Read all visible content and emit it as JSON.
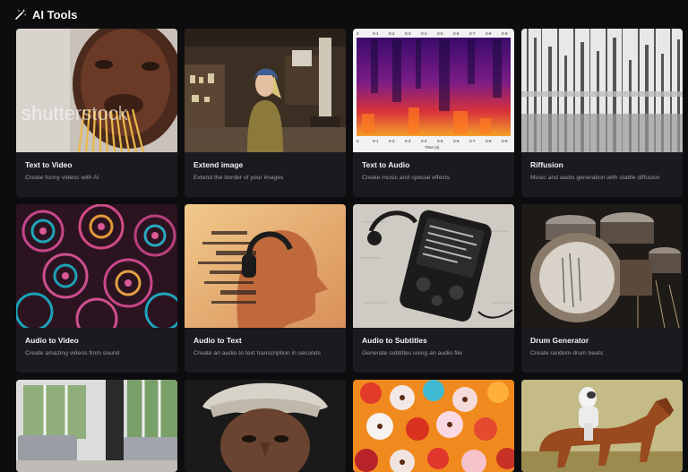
{
  "header": {
    "icon": "magic-wand-icon",
    "title": "AI Tools"
  },
  "cards": [
    {
      "title": "Text to Video",
      "description": "Create funny videos with AI"
    },
    {
      "title": "Extend image",
      "description": "Extend the border of your images"
    },
    {
      "title": "Text to Audio",
      "description": "Create music and special effects"
    },
    {
      "title": "Riffusion",
      "description": "Music and audio generation with stable diffusion"
    },
    {
      "title": "Audio to Video",
      "description": "Create amazing videos from sound"
    },
    {
      "title": "Audio to Text",
      "description": "Create an audio to text transcription in seconds"
    },
    {
      "title": "Audio to Subtitles",
      "description": "Generate subtitles using an audio file"
    },
    {
      "title": "Drum Generator",
      "description": "Create random drum beats"
    }
  ],
  "thumb_text": {
    "watermark": "shutterstock",
    "spectrogram_axis": "Time (s)",
    "spectrogram_ticks": [
      "0",
      "0-1",
      "0-2",
      "0-3",
      "0-4",
      "0-5",
      "0-6",
      "0-7",
      "0-8",
      "0-9"
    ]
  },
  "theme": {
    "background": "#0d0d0f",
    "card": "#1b1b1f",
    "text": "#f4f4f6",
    "muted": "#9a9aa3"
  }
}
